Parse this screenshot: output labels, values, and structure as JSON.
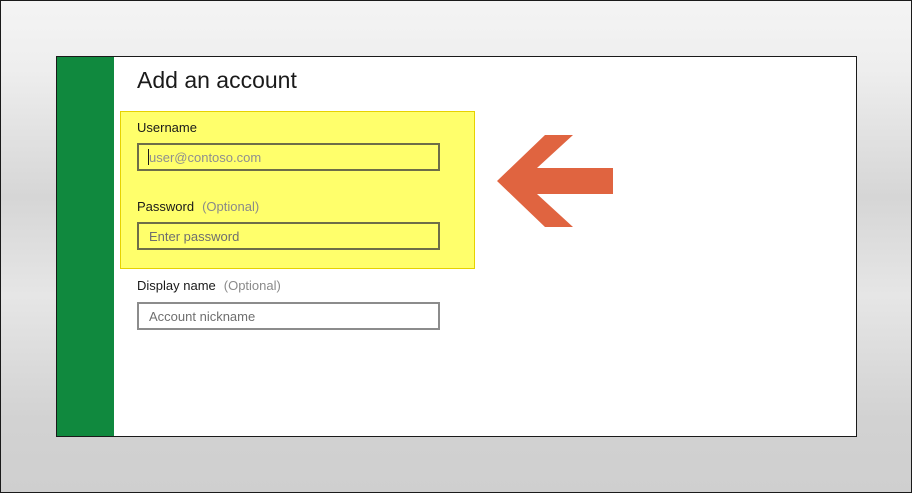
{
  "dialog": {
    "title": "Add an account"
  },
  "fields": {
    "username": {
      "label": "Username",
      "placeholder": "user@contoso.com",
      "value": ""
    },
    "password": {
      "label": "Password",
      "optional": "(Optional)",
      "placeholder": "Enter password",
      "value": ""
    },
    "display_name": {
      "label": "Display name",
      "optional": "(Optional)",
      "placeholder": "Account nickname",
      "value": ""
    }
  },
  "colors": {
    "accent_bar": "#10893e",
    "highlight": "#ffff6b",
    "arrow": "#e06440"
  },
  "annotations": {
    "arrow_icon": "left-arrow-icon"
  }
}
